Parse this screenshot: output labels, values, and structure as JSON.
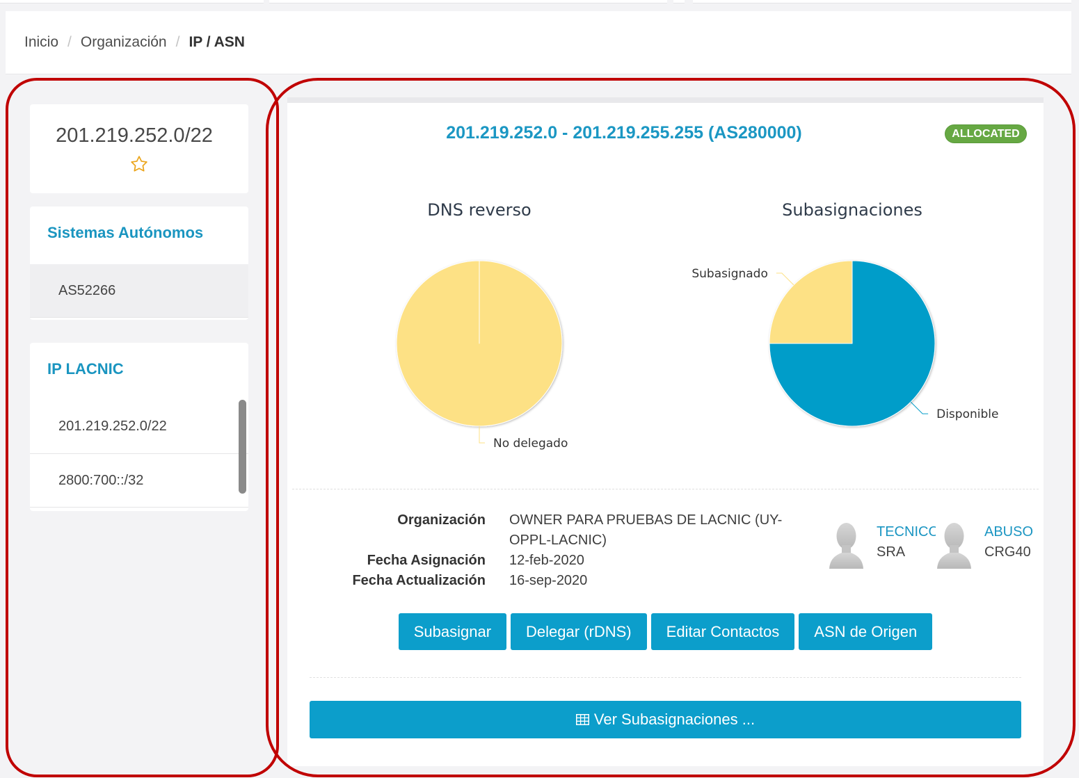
{
  "breadcrumb": {
    "separator": "/",
    "items": [
      {
        "label": "Inicio"
      },
      {
        "label": "Organización"
      },
      {
        "label": "IP / ASN",
        "current": true
      }
    ]
  },
  "sidebar": {
    "resource_card": {
      "prefix": "201.219.252.0/22",
      "favorite_icon": "star-outline-icon"
    },
    "autonomous_systems": {
      "title": "Sistemas Autónomos",
      "items": [
        "AS52266"
      ]
    },
    "ip_lacnic": {
      "title": "IP LACNIC",
      "items": [
        "201.219.252.0/22",
        "2800:700::/32"
      ]
    }
  },
  "main": {
    "title": "201.219.252.0 - 201.219.255.255 (AS280000)",
    "status": "ALLOCATED",
    "details": [
      {
        "label": "Organización",
        "value": "OWNER PARA PRUEBAS DE LACNIC (UY-OPPL-LACNIC)"
      },
      {
        "label": "Fecha Asignación",
        "value": "12-feb-2020"
      },
      {
        "label": "Fecha Actualización",
        "value": "16-sep-2020"
      }
    ],
    "contacts": [
      {
        "role": "TECNICO",
        "handle": "SRA",
        "icon": "user-avatar-icon"
      },
      {
        "role": "ABUSO",
        "handle": "CRG40",
        "icon": "user-avatar-icon"
      }
    ],
    "actions": [
      "Subasignar",
      "Delegar (rDNS)",
      "Editar Contactos",
      "ASN de Origen"
    ],
    "view_subassignments": {
      "label": "Ver Subasignaciones ...",
      "icon": "table-icon"
    }
  },
  "chart_data": [
    {
      "type": "pie",
      "title": "DNS reverso",
      "slices": [
        {
          "label": "No delegado",
          "value": 100,
          "color": "#fde185"
        }
      ]
    },
    {
      "type": "pie",
      "title": "Subasignaciones",
      "slices": [
        {
          "label": "Disponible",
          "value": 75,
          "color": "#069dc9"
        },
        {
          "label": "Subasignado",
          "value": 25,
          "color": "#fde185"
        }
      ]
    }
  ],
  "colors": {
    "accent": "#1b97c3",
    "button": "#0c9ecb",
    "status_allocated": "#66a843",
    "favorite_star": "#eba51c",
    "annotation": "#c00000"
  }
}
